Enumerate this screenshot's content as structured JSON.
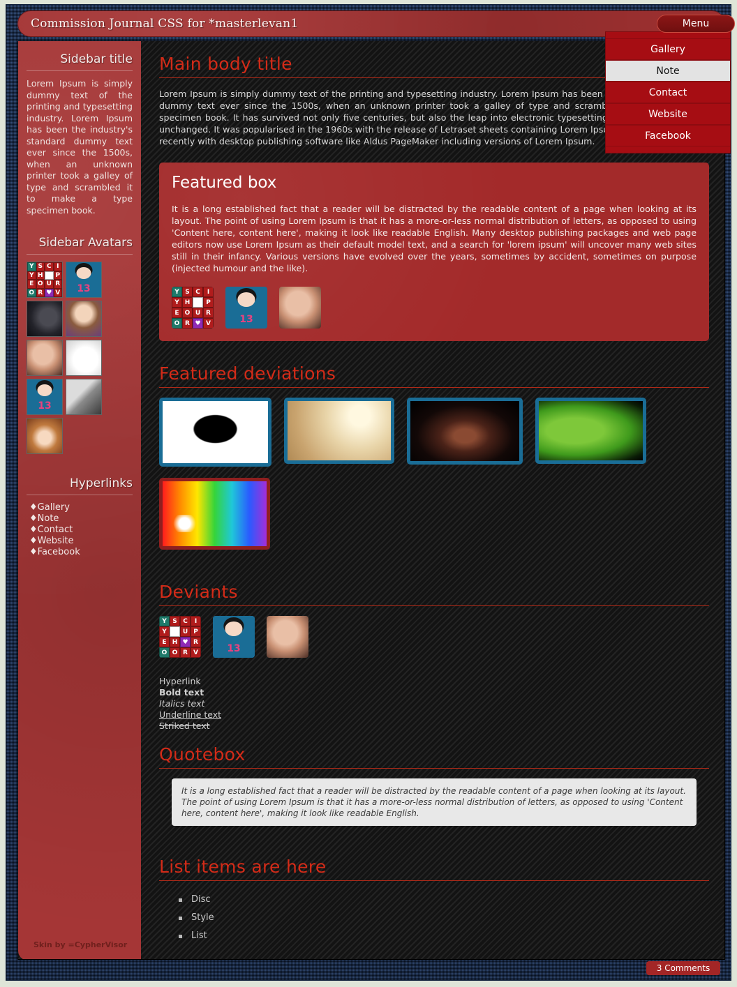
{
  "window": {
    "title": "Commission Journal CSS for *masterlevan1"
  },
  "menu": {
    "button_label": "Menu",
    "items": [
      {
        "label": "Gallery",
        "active": false
      },
      {
        "label": "Note",
        "active": true
      },
      {
        "label": "Contact",
        "active": false
      },
      {
        "label": "Website",
        "active": false
      },
      {
        "label": "Facebook",
        "active": false
      }
    ]
  },
  "sidebar": {
    "title": "Sidebar title",
    "text": "Lorem Ipsum is simply dummy text of the printing and typesetting industry. Lorem Ipsum has been the industry's standard dummy text ever since the 1500s, when an unknown printer took a galley of type and scrambled it to make a type specimen book.",
    "avatars_title": "Sidebar Avatars",
    "avatars": [
      {
        "name": "wordsearch-avatar"
      },
      {
        "name": "doll-13-avatar"
      },
      {
        "name": "black-dragon-avatar"
      },
      {
        "name": "chibi-girl-avatar"
      },
      {
        "name": "woman-photo-avatar"
      },
      {
        "name": "white-bunny-avatar"
      },
      {
        "name": "doll-13-avatar"
      },
      {
        "name": "man-photo-avatar"
      },
      {
        "name": "glasses-girl-avatar"
      }
    ],
    "links_title": "Hyperlinks",
    "links": [
      "Gallery",
      "Note",
      "Contact",
      "Website",
      "Facebook"
    ],
    "credit": "Skin by =CypherVisor"
  },
  "main": {
    "title": "Main body title",
    "text": "Lorem Ipsum is simply dummy text of the printing and typesetting industry. Lorem Ipsum has been the industry's standard dummy text ever since the 1500s, when an unknown printer took a galley of type and scrambled it to make a type specimen book. It has survived not only five centuries, but also the leap into electronic typesetting, remaining essentially unchanged. It was popularised in the 1960s with the release of Letraset sheets containing Lorem Ipsum passages, and more recently with desktop publishing software like Aldus PageMaker including versions of Lorem Ipsum.",
    "featured_box": {
      "title": "Featured box",
      "text": "It is a long established fact that a reader will be distracted by the readable content of a page when looking at its layout. The point of using Lorem Ipsum is that it has a more-or-less normal distribution of letters, as opposed to using 'Content here, content here', making it look like readable English. Many desktop publishing packages and web page editors now use Lorem Ipsum as their default model text, and a search for 'lorem ipsum' will uncover many web sites still in their infancy. Various versions have evolved over the years, sometimes by accident, sometimes on purpose (injected humour and the like)."
    },
    "featured_deviations": {
      "title": "Featured deviations",
      "items": [
        {
          "name": "gothic-portrait-thumb",
          "border": "blue"
        },
        {
          "name": "champagne-glasses-thumb",
          "border": "blue"
        },
        {
          "name": "screaming-face-thumb",
          "border": "blue"
        },
        {
          "name": "green-leaf-thumb",
          "border": "blue"
        },
        {
          "name": "rainbow-light-thumb",
          "border": "red"
        }
      ]
    },
    "deviants": {
      "title": "Deviants",
      "avatars": [
        {
          "name": "wordsearch-avatar"
        },
        {
          "name": "doll-13-avatar"
        },
        {
          "name": "woman-photo-avatar"
        }
      ]
    },
    "text_styles": {
      "hyperlink": "Hyperlink",
      "bold": "Bold text",
      "italics": "Italics text",
      "underline": "Underline text",
      "striked": "Striked text"
    },
    "quotebox": {
      "title": "Quotebox",
      "text": "It is a long established fact that a reader will be distracted by the readable content of a page when looking at its layout. The point of using Lorem Ipsum is that it has a more-or-less normal distribution of letters, as opposed to using 'Content here, content here', making it look like readable English."
    },
    "list_section": {
      "title": "List items are here",
      "items": [
        "Disc",
        "Style",
        "List"
      ]
    }
  },
  "footer": {
    "comments_label": "3 Comments"
  },
  "colors": {
    "accent_red": "#d32b18",
    "panel_red": "#a53636",
    "menu_red": "#a60d13",
    "thumb_blue": "#1a6d96",
    "frame_navy": "#1d3a6b",
    "page_bg": "#dfe5d8"
  },
  "wordsearch_letters": [
    "Y",
    "S",
    "C",
    "I",
    "Y",
    "H",
    "",
    "P",
    "E",
    "O",
    "U",
    "R",
    "O",
    "R",
    "♥",
    "V"
  ]
}
